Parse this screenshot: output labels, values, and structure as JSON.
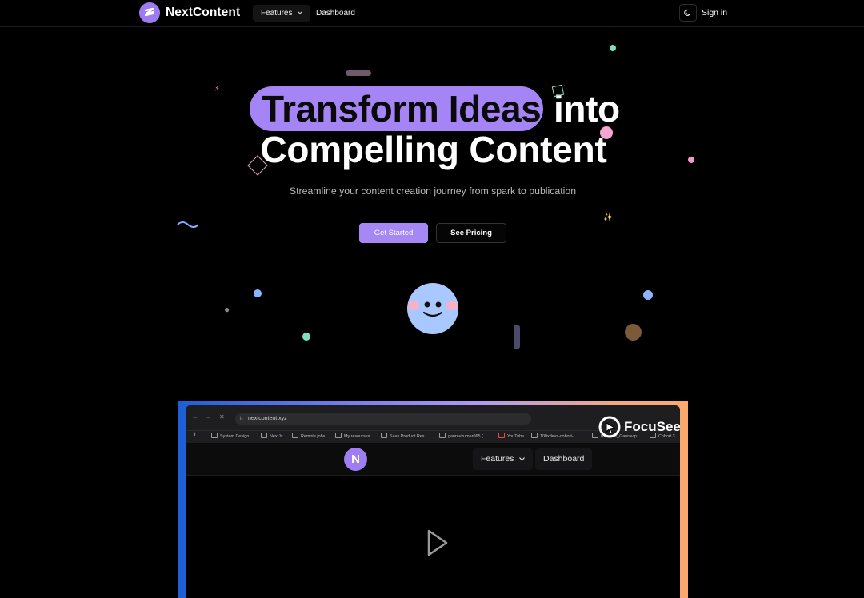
{
  "header": {
    "brand_name": "NextContent",
    "nav": [
      {
        "label": "Features",
        "has_dropdown": true
      },
      {
        "label": "Dashboard"
      }
    ],
    "theme_toggle_icon": "moon-icon",
    "sign_in_label": "Sign in"
  },
  "hero": {
    "headline_highlight": "Transform Ideas",
    "headline_rest": "into",
    "headline_line2": "Compelling Content",
    "subtitle": "Streamline your content creation journey from spark to publication",
    "primary_cta": "Get Started",
    "secondary_cta": "See Pricing",
    "highlight_color": "#a585f5"
  },
  "video": {
    "url": "nextcontent.xyz",
    "watermark": "FocuSee",
    "bookmarks": [
      "System Design",
      "NextJs",
      "Remote jobs",
      "My resourses",
      "Saas Product Res...",
      "gauravkumar065 (...",
      "YouTube",
      "100xdevs-cohort-...",
      "Resume_Gaurav.p...",
      "Cohort 3..."
    ],
    "inner_nav": {
      "logo_letter": "N",
      "features_label": "Features",
      "dashboard_label": "Dashboard"
    },
    "play_icon": "play-icon"
  },
  "colors": {
    "background": "#000000",
    "accent": "#a587f6",
    "mascot": "#a9c8ff"
  }
}
